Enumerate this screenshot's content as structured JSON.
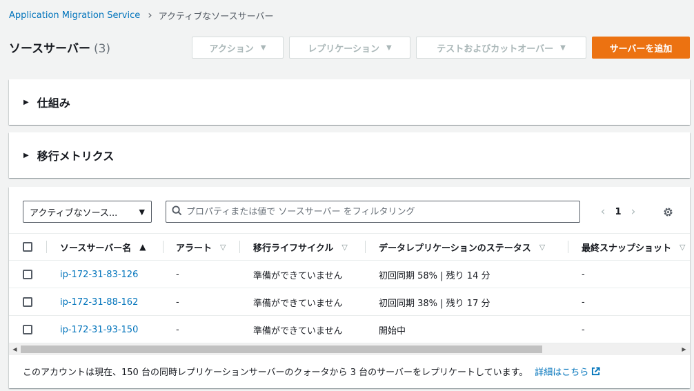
{
  "breadcrumb": {
    "service": "Application Migration Service",
    "current": "アクティブなソースサーバー"
  },
  "header": {
    "title": "ソースサーバー",
    "count": "(3)",
    "buttons": {
      "actions": "アクション",
      "replication": "レプリケーション",
      "test_cutover": "テストおよびカットオーバー",
      "add_server": "サーバーを追加"
    }
  },
  "sections": {
    "how_it_works": "仕組み",
    "migration_metrics": "移行メトリクス"
  },
  "filter": {
    "select_value": "アクティブなソース...",
    "search_placeholder": "プロパティまたは値で ソースサーバー をフィルタリング",
    "page": "1"
  },
  "table": {
    "columns": [
      "ソースサーバー名",
      "アラート",
      "移行ライフサイクル",
      "データレプリケーションのステータス",
      "最終スナップショット"
    ],
    "rows": [
      {
        "name": "ip-172-31-83-126",
        "alert": "-",
        "lifecycle": "準備ができていません",
        "replication": "初回同期 58% | 残り 14 分",
        "snapshot": "-"
      },
      {
        "name": "ip-172-31-88-162",
        "alert": "-",
        "lifecycle": "準備ができていません",
        "replication": "初回同期 38% | 残り 17 分",
        "snapshot": "-"
      },
      {
        "name": "ip-172-31-93-150",
        "alert": "-",
        "lifecycle": "準備ができていません",
        "replication": "開始中",
        "snapshot": "-"
      }
    ]
  },
  "footer": {
    "note": "このアカウントは現在、150 台の同時レプリケーションサーバーのクォータから 3 台のサーバーをレプリケートしています。",
    "link": "詳細はこちら"
  },
  "colors": {
    "accent": "#ec7211",
    "link": "#0073bb",
    "background": "#f2f3f3"
  }
}
